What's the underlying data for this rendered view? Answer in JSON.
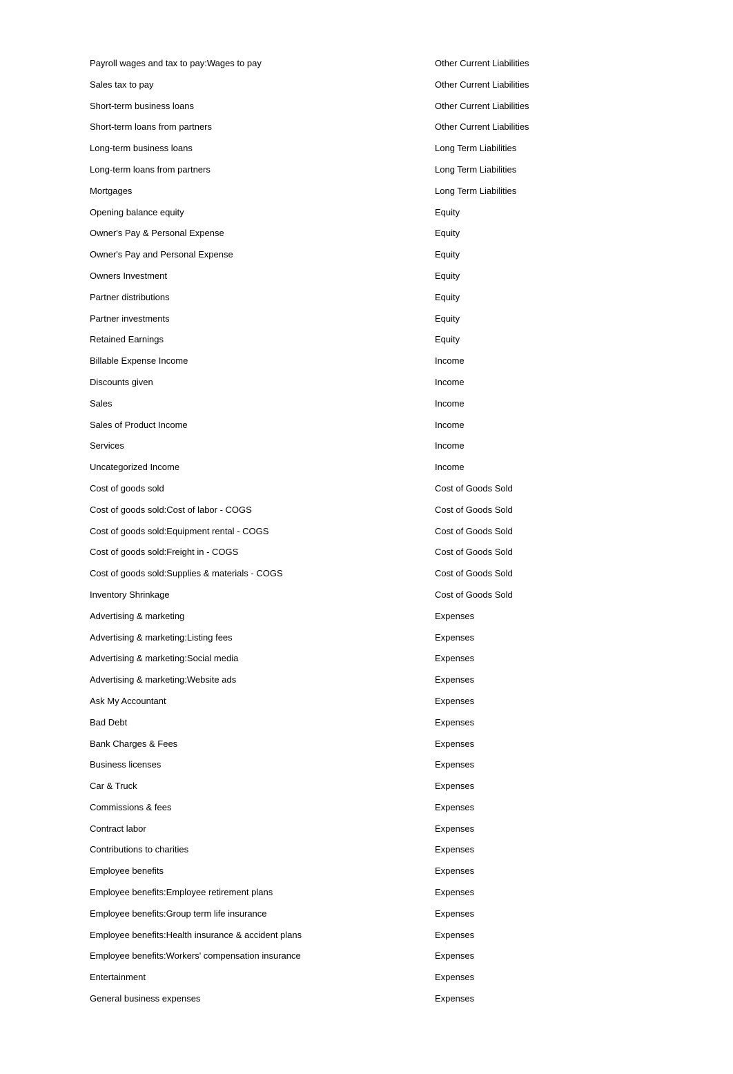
{
  "rows": [
    {
      "name": "Payroll wages and tax to pay:Wages to pay",
      "type": "Other Current Liabilities"
    },
    {
      "name": "Sales tax to pay",
      "type": "Other Current Liabilities"
    },
    {
      "name": "Short-term business loans",
      "type": "Other Current Liabilities"
    },
    {
      "name": "Short-term loans from partners",
      "type": "Other Current Liabilities"
    },
    {
      "name": "Long-term business loans",
      "type": "Long Term Liabilities"
    },
    {
      "name": "Long-term loans from partners",
      "type": "Long Term Liabilities"
    },
    {
      "name": "Mortgages",
      "type": "Long Term Liabilities"
    },
    {
      "name": "Opening balance equity",
      "type": "Equity"
    },
    {
      "name": "Owner's Pay & Personal Expense",
      "type": "Equity"
    },
    {
      "name": "Owner's Pay and Personal Expense",
      "type": "Equity"
    },
    {
      "name": "Owners Investment",
      "type": "Equity"
    },
    {
      "name": "Partner distributions",
      "type": "Equity"
    },
    {
      "name": "Partner investments",
      "type": "Equity"
    },
    {
      "name": "Retained Earnings",
      "type": "Equity"
    },
    {
      "name": "Billable Expense Income",
      "type": "Income"
    },
    {
      "name": "Discounts given",
      "type": "Income"
    },
    {
      "name": "Sales",
      "type": "Income"
    },
    {
      "name": "Sales of Product Income",
      "type": "Income"
    },
    {
      "name": "Services",
      "type": "Income"
    },
    {
      "name": "Uncategorized Income",
      "type": "Income"
    },
    {
      "name": "Cost of goods sold",
      "type": "Cost of Goods Sold"
    },
    {
      "name": "Cost of goods sold:Cost of labor - COGS",
      "type": "Cost of Goods Sold"
    },
    {
      "name": "Cost of goods sold:Equipment rental - COGS",
      "type": "Cost of Goods Sold"
    },
    {
      "name": "Cost of goods sold:Freight in - COGS",
      "type": "Cost of Goods Sold"
    },
    {
      "name": "Cost of goods sold:Supplies & materials - COGS",
      "type": "Cost of Goods Sold"
    },
    {
      "name": "Inventory Shrinkage",
      "type": "Cost of Goods Sold"
    },
    {
      "name": "Advertising & marketing",
      "type": "Expenses"
    },
    {
      "name": "Advertising & marketing:Listing fees",
      "type": "Expenses"
    },
    {
      "name": "Advertising & marketing:Social media",
      "type": "Expenses"
    },
    {
      "name": "Advertising & marketing:Website ads",
      "type": "Expenses"
    },
    {
      "name": "Ask My Accountant",
      "type": "Expenses"
    },
    {
      "name": "Bad Debt",
      "type": "Expenses"
    },
    {
      "name": "Bank Charges & Fees",
      "type": "Expenses"
    },
    {
      "name": "Business licenses",
      "type": "Expenses"
    },
    {
      "name": "Car & Truck",
      "type": "Expenses"
    },
    {
      "name": "Commissions & fees",
      "type": "Expenses"
    },
    {
      "name": "Contract labor",
      "type": "Expenses"
    },
    {
      "name": "Contributions to charities",
      "type": "Expenses"
    },
    {
      "name": "Employee benefits",
      "type": "Expenses"
    },
    {
      "name": "Employee benefits:Employee retirement plans",
      "type": "Expenses"
    },
    {
      "name": "Employee benefits:Group term life insurance",
      "type": "Expenses"
    },
    {
      "name": "Employee benefits:Health insurance & accident plans",
      "type": "Expenses"
    },
    {
      "name": "Employee benefits:Workers' compensation insurance",
      "type": "Expenses"
    },
    {
      "name": "Entertainment",
      "type": "Expenses"
    },
    {
      "name": "General business expenses",
      "type": "Expenses"
    }
  ]
}
